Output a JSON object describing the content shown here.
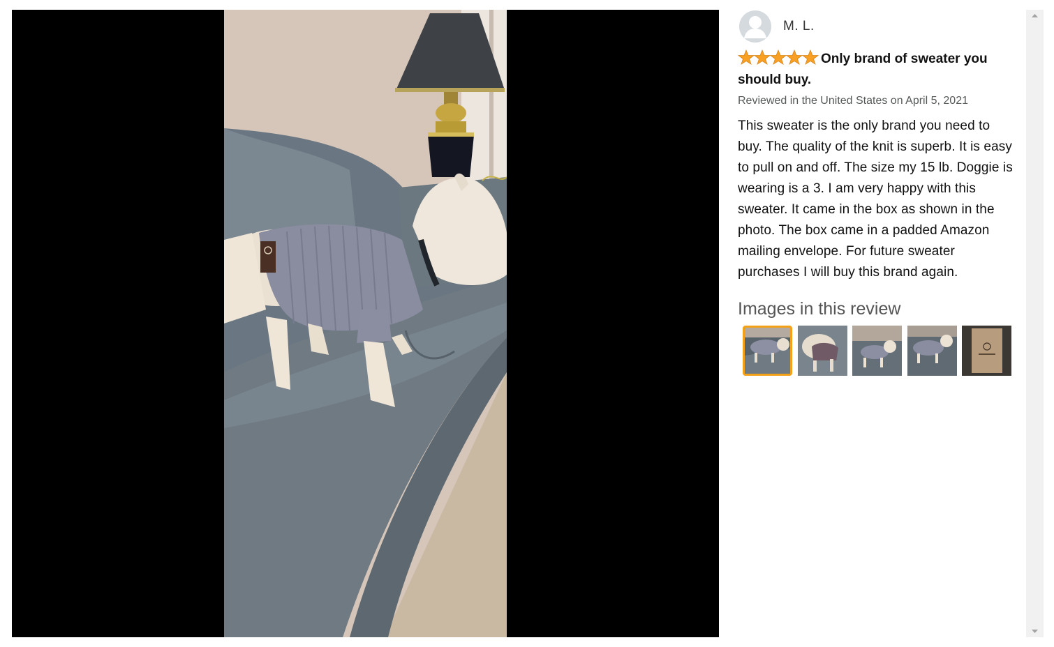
{
  "reviewer": {
    "name": "M. L.",
    "avatar_icon": "user-avatar-icon"
  },
  "review": {
    "rating": 5,
    "rating_max": 5,
    "title": "Only brand of sweater you should buy.",
    "meta": "Reviewed in the United States on April 5, 2021",
    "body": "This sweater is the only brand you need to buy. The quality of the knit is superb. It is easy to pull on and off. The size my 15 lb. Doggie is wearing is a 3. I am very happy with this sweater. It came in the box as shown in the photo. The box came in a padded Amazon mailing envelope. For future sweater purchases I will buy this brand again."
  },
  "images_section": {
    "heading": "Images in this review",
    "selected_index": 0,
    "count": 5
  },
  "colors": {
    "star": "#f7a023",
    "selected_border": "#f4a11a",
    "viewer_bg": "#000000"
  }
}
